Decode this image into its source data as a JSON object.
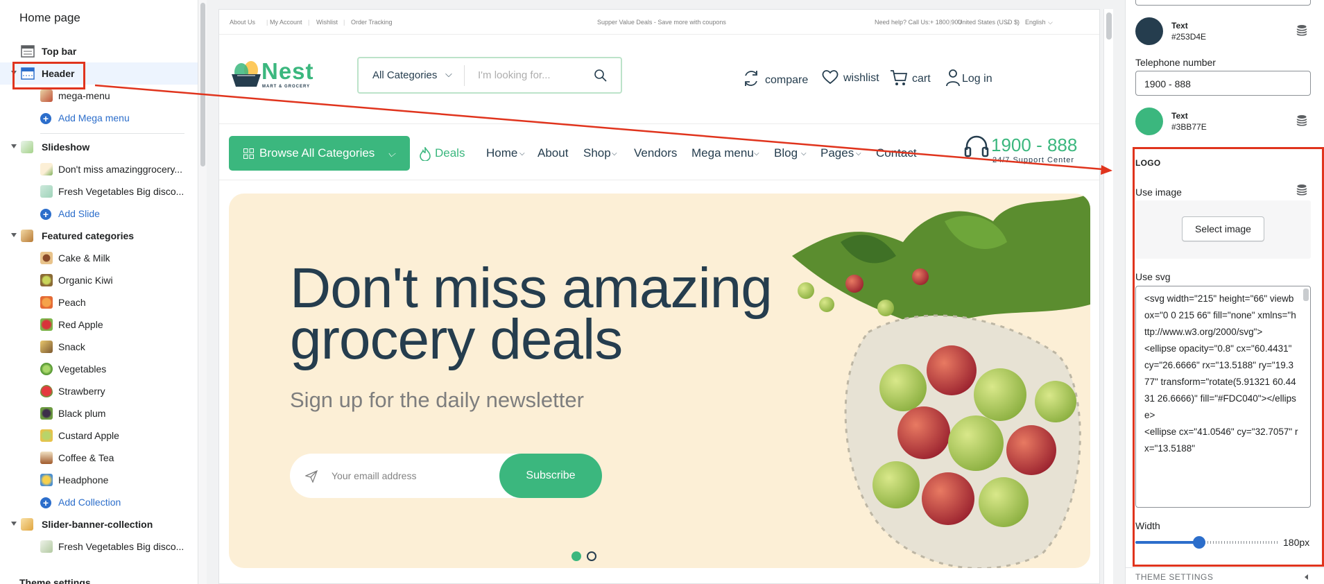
{
  "sidebar": {
    "title": "Home page",
    "items": [
      {
        "label": "Top bar"
      },
      {
        "label": "Header"
      },
      {
        "label": "mega-menu"
      },
      {
        "label": "Add Mega menu"
      },
      {
        "label": "Slideshow"
      },
      {
        "label": "Don't miss amazinggrocery..."
      },
      {
        "label": "Fresh Vegetables Big disco..."
      },
      {
        "label": "Add Slide"
      },
      {
        "label": "Featured categories"
      },
      {
        "label": "Cake & Milk"
      },
      {
        "label": "Organic Kiwi"
      },
      {
        "label": "Peach"
      },
      {
        "label": "Red Apple"
      },
      {
        "label": "Snack"
      },
      {
        "label": "Vegetables"
      },
      {
        "label": "Strawberry"
      },
      {
        "label": "Black plum"
      },
      {
        "label": "Custard Apple"
      },
      {
        "label": "Coffee & Tea"
      },
      {
        "label": "Headphone"
      },
      {
        "label": "Add Collection"
      },
      {
        "label": "Slider-banner-collection"
      },
      {
        "label": "Fresh Vegetables Big disco..."
      }
    ],
    "bottom": "Theme settings"
  },
  "site": {
    "topbar": {
      "links": [
        "About Us",
        "My Account",
        "Wishlist",
        "Order Tracking"
      ],
      "promo": "Supper Value Deals - Save more with coupons",
      "help": "Need help? Call Us:+ 1800 900",
      "currency": "United States (USD $)",
      "language": "English"
    },
    "logo": {
      "name": "Nest",
      "tagline": "MART & GROCERY"
    },
    "search": {
      "category": "All Categories",
      "placeholder": "I'm looking for..."
    },
    "header_actions": [
      "compare",
      "wishlist",
      "cart",
      "Log in"
    ],
    "browse": "Browse All Categories",
    "nav": [
      "Deals",
      "Home",
      "About",
      "Shop",
      "Vendors",
      "Mega menu",
      "Blog",
      "Pages",
      "Contact"
    ],
    "phone": {
      "number": "1900 - 888",
      "support": "24/7 Support Center"
    },
    "hero": {
      "title_line1": "Don't miss amazing",
      "title_line2": "grocery deals",
      "subtitle": "Sign up for the daily newsletter",
      "email_placeholder": "Your emaill address",
      "subscribe": "Subscribe"
    }
  },
  "settings": {
    "color1": {
      "label": "Text",
      "hex": "#253D4E"
    },
    "telephone_label": "Telephone number",
    "telephone_value": "1900 - 888",
    "color2": {
      "label": "Text",
      "hex": "#3BB77E"
    },
    "logo_section": "LOGO",
    "use_image": "Use image",
    "select_image": "Select image",
    "use_svg": "Use svg",
    "svg_code": "<svg width=\"215\" height=\"66\" viewbox=\"0 0 215 66\" fill=\"none\" xmlns=\"http://www.w3.org/2000/svg\">\n<ellipse opacity=\"0.8\" cx=\"60.4431\" cy=\"26.6666\" rx=\"13.5188\" ry=\"19.377\" transform=\"rotate(5.91321 60.4431 26.6666)\" fill=\"#FDC040\"></ellipse>\n<ellipse cx=\"41.0546\" cy=\"32.7057\" rx=\"13.5188\"",
    "width_label": "Width",
    "width_value": "180px",
    "width_fraction": 0.45,
    "theme_settings": "THEME SETTINGS"
  },
  "colors": {
    "brand_green": "#3BB77E",
    "dark_text": "#253D4E",
    "annotation_red": "#E0341D",
    "selection_blue": "#2C6ECB"
  }
}
